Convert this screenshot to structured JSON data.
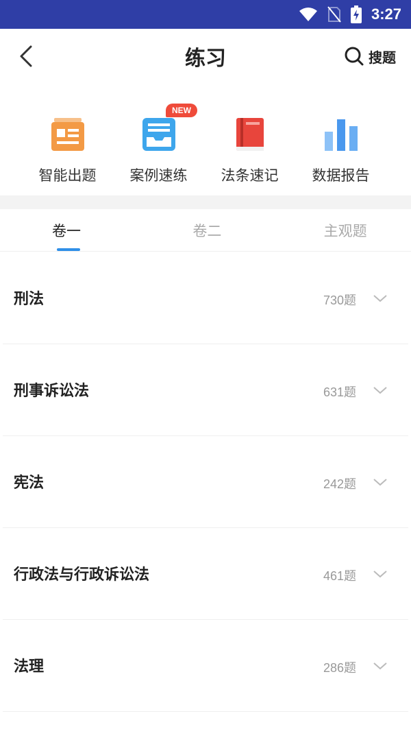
{
  "status_bar": {
    "time": "3:27"
  },
  "header": {
    "title": "练习",
    "search_label": "搜题"
  },
  "quick_entries": [
    {
      "label": "智能出题",
      "icon": "newspaper-icon",
      "color": "#f39a45"
    },
    {
      "label": "案例速练",
      "icon": "document-tray-icon",
      "color": "#3ea6ec",
      "badge": "NEW"
    },
    {
      "label": "法条速记",
      "icon": "book-icon",
      "color": "#e8453c"
    },
    {
      "label": "数据报告",
      "icon": "bar-chart-icon",
      "color": "#4a98ee"
    }
  ],
  "tabs": [
    {
      "label": "卷一",
      "active": true
    },
    {
      "label": "卷二",
      "active": false
    },
    {
      "label": "主观题",
      "active": false
    }
  ],
  "subjects": [
    {
      "name": "刑法",
      "count": "730题"
    },
    {
      "name": "刑事诉讼法",
      "count": "631题"
    },
    {
      "name": "宪法",
      "count": "242题"
    },
    {
      "name": "行政法与行政诉讼法",
      "count": "461题"
    },
    {
      "name": "法理",
      "count": "286题"
    }
  ],
  "colors": {
    "status_bar": "#2f3ea6",
    "accent": "#2f8fe8",
    "badge": "#ef4b3a"
  }
}
